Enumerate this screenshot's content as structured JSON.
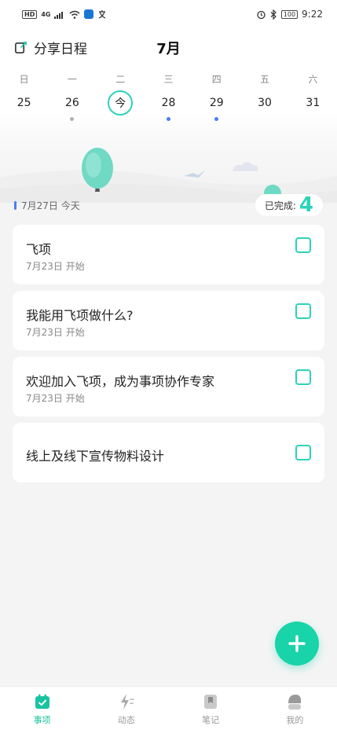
{
  "status_bar": {
    "left_badges": [
      "HD",
      "4G"
    ],
    "time": "9:22",
    "battery": "100"
  },
  "header": {
    "share_label": "分享日程",
    "month": "7月"
  },
  "calendar": {
    "days": [
      {
        "weekday": "日",
        "date": "25",
        "marker": "none",
        "today": false
      },
      {
        "weekday": "一",
        "date": "26",
        "marker": "gray",
        "today": false
      },
      {
        "weekday": "二",
        "date": "今",
        "marker": "none",
        "today": true
      },
      {
        "weekday": "三",
        "date": "28",
        "marker": "blue",
        "today": false
      },
      {
        "weekday": "四",
        "date": "29",
        "marker": "blue",
        "today": false
      },
      {
        "weekday": "五",
        "date": "30",
        "marker": "none",
        "today": false
      },
      {
        "weekday": "六",
        "date": "31",
        "marker": "none",
        "today": false
      }
    ]
  },
  "summary": {
    "date_label": "7月27日 今天",
    "done_label": "已完成:",
    "done_count": "4"
  },
  "tasks": [
    {
      "title": "飞项",
      "subtitle": "7月23日 开始"
    },
    {
      "title": "我能用飞项做什么?",
      "subtitle": "7月23日 开始"
    },
    {
      "title": "欢迎加入飞项，成为事项协作专家",
      "subtitle": "7月23日 开始"
    },
    {
      "title": "线上及线下宣传物料设计",
      "subtitle": ""
    }
  ],
  "fab": {
    "icon": "plus-icon"
  },
  "tabbar": {
    "items": [
      {
        "label": "事项",
        "icon": "calendar-check-icon",
        "active": true
      },
      {
        "label": "动态",
        "icon": "activity-icon",
        "active": false
      },
      {
        "label": "笔记",
        "icon": "bookmark-icon",
        "active": false
      },
      {
        "label": "我的",
        "icon": "profile-icon",
        "active": false
      }
    ]
  },
  "colors": {
    "accent": "#2bd3b9",
    "fab": "#19d3a9",
    "event_dot": "#4d7cf5",
    "tab_active": "#19c3a0"
  }
}
